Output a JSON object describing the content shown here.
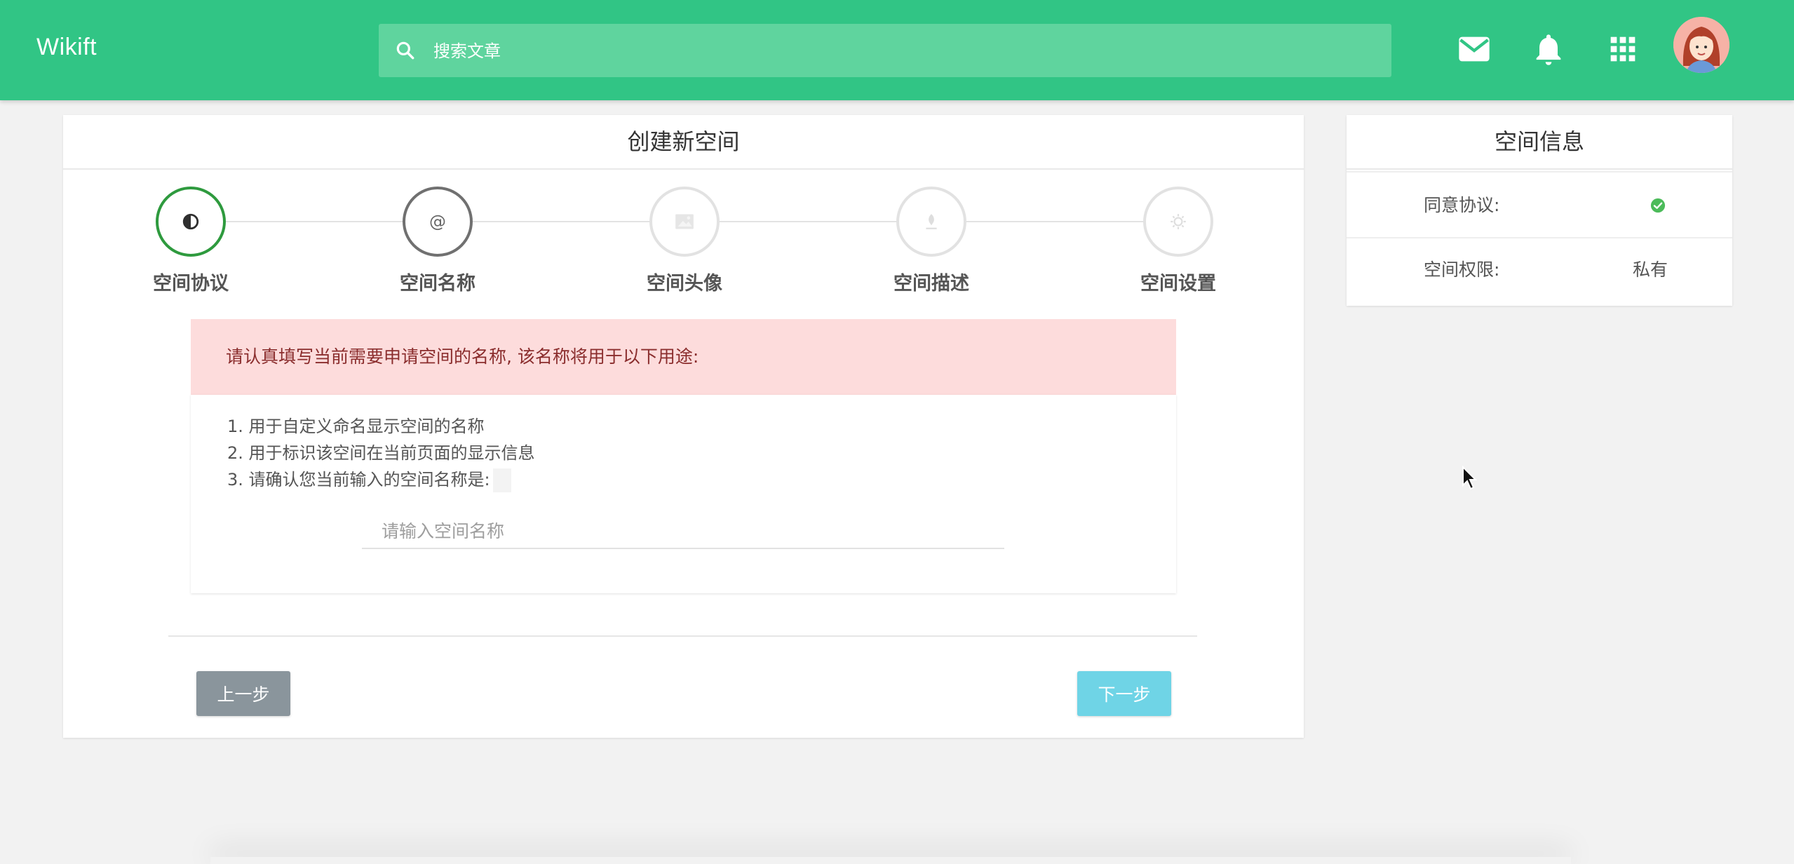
{
  "header": {
    "brand": "Wikift",
    "search_placeholder": "搜索文章",
    "icons": [
      "mail-icon",
      "bell-icon",
      "apps-grid-icon"
    ]
  },
  "main": {
    "title": "创建新空间",
    "steps": [
      {
        "label": "空间协议",
        "icon": "half-circle-icon",
        "state": "active"
      },
      {
        "label": "空间名称",
        "icon": "at-icon",
        "state": "current"
      },
      {
        "label": "空间头像",
        "icon": "image-icon",
        "state": "pending"
      },
      {
        "label": "空间描述",
        "icon": "pen-icon",
        "state": "pending"
      },
      {
        "label": "空间设置",
        "icon": "settings-icon",
        "state": "pending"
      }
    ],
    "alert": "请认真填写当前需要申请空间的名称, 该名称将用于以下用途:",
    "list": [
      "1. 用于自定义命名显示空间的名称",
      "2. 用于标识该空间在当前页面的显示信息",
      "3. 请确认您当前输入的空间名称是:"
    ],
    "name_input": {
      "value": "",
      "placeholder": "请输入空间名称"
    },
    "prev_label": "上一步",
    "next_label": "下一步"
  },
  "side": {
    "title": "空间信息",
    "rows": [
      {
        "key": "同意协议:",
        "value_icon": "check-circle-icon"
      },
      {
        "key": "空间权限:",
        "value": "私有"
      }
    ]
  },
  "colors": {
    "header": "#31c585",
    "active_step": "#2e9a3e",
    "current_step": "#707070",
    "alert_bg": "#fddcdc",
    "prev_btn": "#8a959c",
    "next_btn": "#6fd4e6",
    "check": "#4cbb5a"
  }
}
